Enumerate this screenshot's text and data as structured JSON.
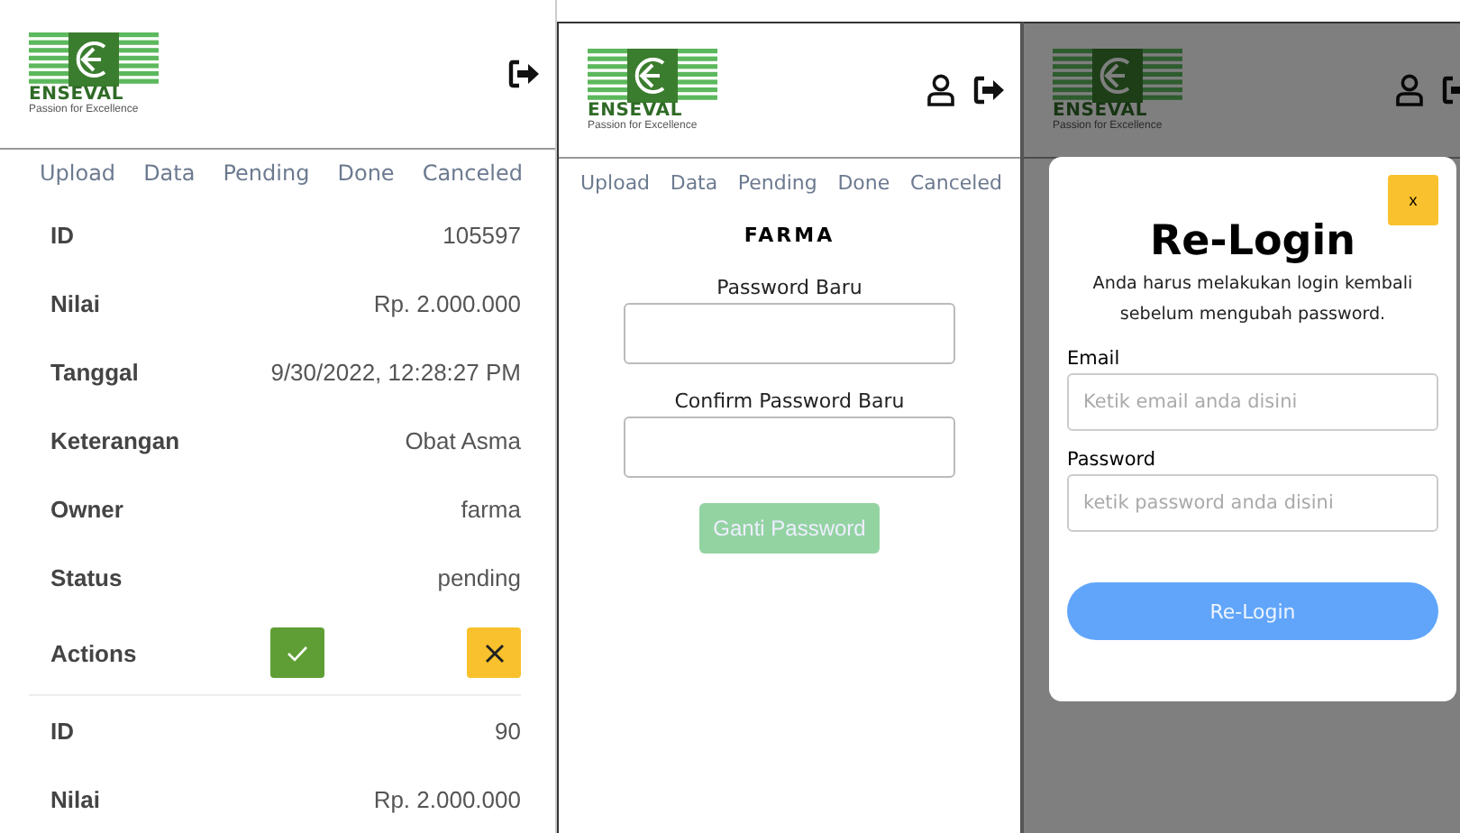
{
  "screens": [
    {
      "kind": "records",
      "header": {
        "logo_name": "ENSEVAL",
        "logo_tagline": "Passion for Excellence",
        "user_icon": false
      },
      "tabs": [
        {
          "label": "Upload",
          "selected": false
        },
        {
          "label": "Data",
          "selected": false
        },
        {
          "label": "Pending",
          "selected": false
        },
        {
          "label": "Done",
          "selected": false
        },
        {
          "label": "Canceled",
          "selected": false
        }
      ],
      "records": [
        {
          "fields": [
            {
              "label": "ID",
              "value": "105597"
            },
            {
              "label": "Nilai",
              "value": "Rp. 2.000.000"
            },
            {
              "label": "Tanggal",
              "value": "9/30/2022, 12:28:27 PM"
            },
            {
              "label": "Keterangan",
              "value": "Obat Asma"
            },
            {
              "label": "Owner",
              "value": "farma"
            },
            {
              "label": "Status",
              "value": "pending"
            }
          ],
          "actions_label": "Actions"
        },
        {
          "fields": [
            {
              "label": "ID",
              "value": "90"
            },
            {
              "label": "Nilai",
              "value": "Rp. 2.000.000"
            }
          ]
        }
      ]
    },
    {
      "kind": "change_password",
      "header": {
        "logo_name": "ENSEVAL",
        "logo_tagline": "Passion for Excellence",
        "user_icon": true
      },
      "tabs": [
        {
          "label": "Upload",
          "selected": false
        },
        {
          "label": "Data",
          "selected": false
        },
        {
          "label": "Pending",
          "selected": false
        },
        {
          "label": "Done",
          "selected": false
        },
        {
          "label": "Canceled",
          "selected": false
        }
      ],
      "user_name": "FARMA",
      "fields": [
        {
          "label": "Password Baru"
        },
        {
          "label": "Confirm Password Baru"
        }
      ],
      "submit": {
        "label": "Ganti Password",
        "disabled": true
      }
    },
    {
      "kind": "relogin",
      "header": {
        "logo_name": "ENSEVAL",
        "logo_tagline": "Passion for Excellence",
        "user_icon": true
      },
      "modal": {
        "close": "x",
        "title": "Re-Login",
        "message": "Anda harus melakukan login kembali sebelum mengubah password.",
        "fields": [
          {
            "label": "Email",
            "placeholder": "Ketik email anda disini"
          },
          {
            "label": "Password",
            "placeholder": "ketik password anda disini"
          }
        ],
        "submit": "Re-Login"
      }
    }
  ]
}
